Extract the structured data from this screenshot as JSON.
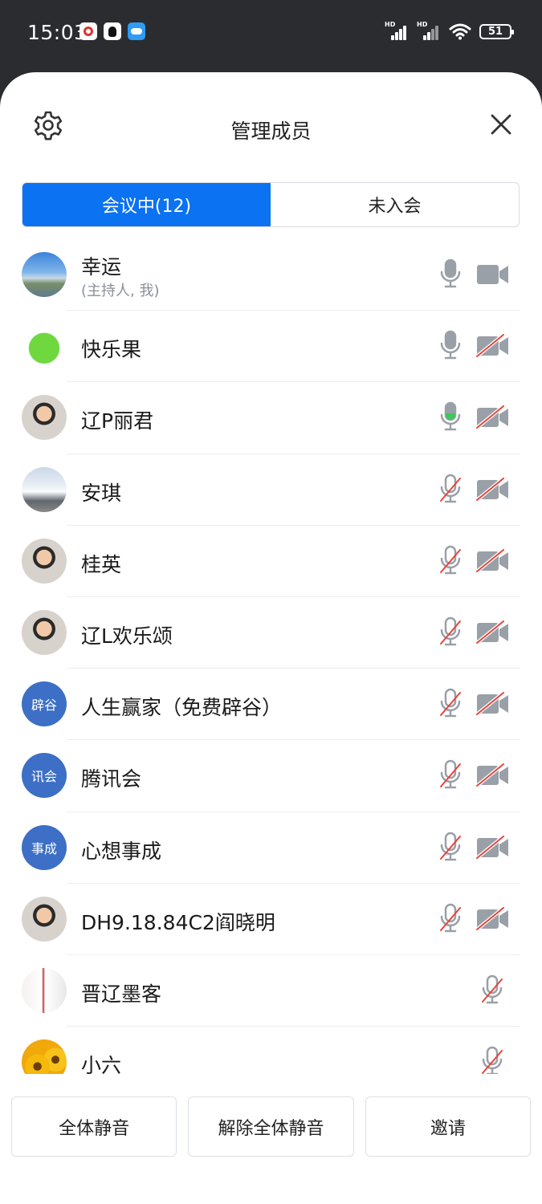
{
  "status_bar": {
    "time": "15:03",
    "battery": "51",
    "hd1": "HD",
    "hd2": "HD"
  },
  "header": {
    "title": "管理成员"
  },
  "tabs": [
    {
      "label": "会议中(12)",
      "active": true
    },
    {
      "label": "未入会",
      "active": false
    }
  ],
  "members": [
    {
      "name": "幸运",
      "sub": "(主持人, 我)",
      "avatar": "photo-landscape",
      "mic": "on",
      "camera": "on"
    },
    {
      "name": "快乐果",
      "avatar": "photo-apple-cartoon",
      "mic": "on",
      "camera": "off"
    },
    {
      "name": "辽P丽君",
      "avatar": "photo-person",
      "mic": "speaking",
      "camera": "off"
    },
    {
      "name": "安琪",
      "avatar": "photo-ship",
      "mic": "off",
      "camera": "off"
    },
    {
      "name": "桂英",
      "avatar": "photo-person",
      "mic": "off",
      "camera": "off"
    },
    {
      "name": "辽L欢乐颂",
      "avatar": "photo-person",
      "mic": "off",
      "camera": "off"
    },
    {
      "name": "人生赢家（免费辟谷）",
      "avatar_text": "辟谷",
      "mic": "off",
      "camera": "off"
    },
    {
      "name": "腾讯会",
      "avatar_text": "讯会",
      "mic": "off",
      "camera": "off"
    },
    {
      "name": "心想事成",
      "avatar_text": "事成",
      "mic": "off",
      "camera": "off"
    },
    {
      "name": "DH9.18.84C2阎晓明",
      "avatar": "photo-person",
      "mic": "off",
      "camera": "off"
    },
    {
      "name": "晋辽墨客",
      "avatar": "photo-calligraphy",
      "mic": "off",
      "camera": "none"
    },
    {
      "name": "小六",
      "avatar": "photo-sunflowers",
      "mic": "off",
      "camera": "none"
    }
  ],
  "actions": {
    "mute_all": "全体静音",
    "unmute_all": "解除全体静音",
    "invite": "邀请"
  },
  "colors": {
    "accent": "#0b72f2",
    "icon_gray": "#9aa0a8",
    "off_red": "#e5453d",
    "speaking": "#3cc85a",
    "avatar_text_bg": "#3c6fc5"
  }
}
